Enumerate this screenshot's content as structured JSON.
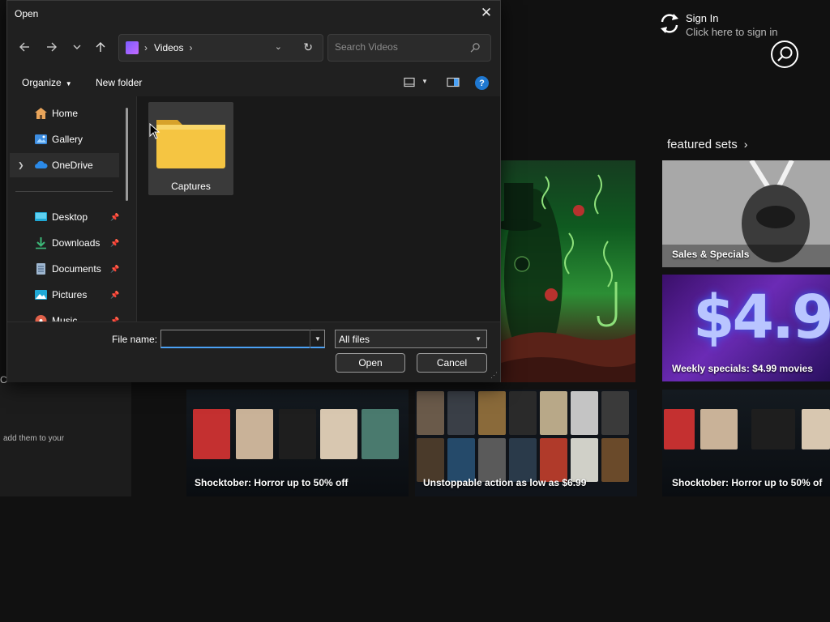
{
  "dialog": {
    "title": "Open",
    "close_label": "✕",
    "address": {
      "location": "Videos",
      "separator": "›"
    },
    "search": {
      "placeholder": "Search Videos"
    },
    "toolbar": {
      "organize": "Organize",
      "new_folder": "New folder"
    },
    "nav_items": [
      {
        "label": "Home",
        "icon": "home-icon",
        "pinned": false
      },
      {
        "label": "Gallery",
        "icon": "gallery-icon",
        "pinned": false
      },
      {
        "label": "OneDrive",
        "icon": "onedrive-icon",
        "pinned": false,
        "expandable": true
      },
      {
        "label": "Desktop",
        "icon": "desktop-icon",
        "pinned": true
      },
      {
        "label": "Downloads",
        "icon": "downloads-icon",
        "pinned": true
      },
      {
        "label": "Documents",
        "icon": "documents-icon",
        "pinned": true
      },
      {
        "label": "Pictures",
        "icon": "pictures-icon",
        "pinned": true
      },
      {
        "label": "Music",
        "icon": "music-icon",
        "pinned": true
      }
    ],
    "folders": [
      {
        "name": "Captures"
      }
    ],
    "file_name": {
      "label": "File name:",
      "value": ""
    },
    "file_type": {
      "selected": "All files"
    },
    "buttons": {
      "open": "Open",
      "cancel": "Cancel"
    },
    "accent_color": "#4ba1f5",
    "folder_color": "#f5c542"
  },
  "store": {
    "signin": {
      "title": "Sign In",
      "subtitle": "Click here to sign in"
    },
    "featured_heading": "featured sets",
    "featured_chevron": "›",
    "tiles": [
      {
        "label": "Sales & Specials"
      },
      {
        "label": "Weekly specials: $4.99 movies",
        "price": "$4.99"
      }
    ],
    "collections": [
      {
        "label": "Shocktober: Horror up to 50% off"
      },
      {
        "label": "Unstoppable action as low as $6.99"
      },
      {
        "label": "Shocktober: Horror up to 50% of"
      }
    ],
    "left_hint": "add them to your"
  }
}
